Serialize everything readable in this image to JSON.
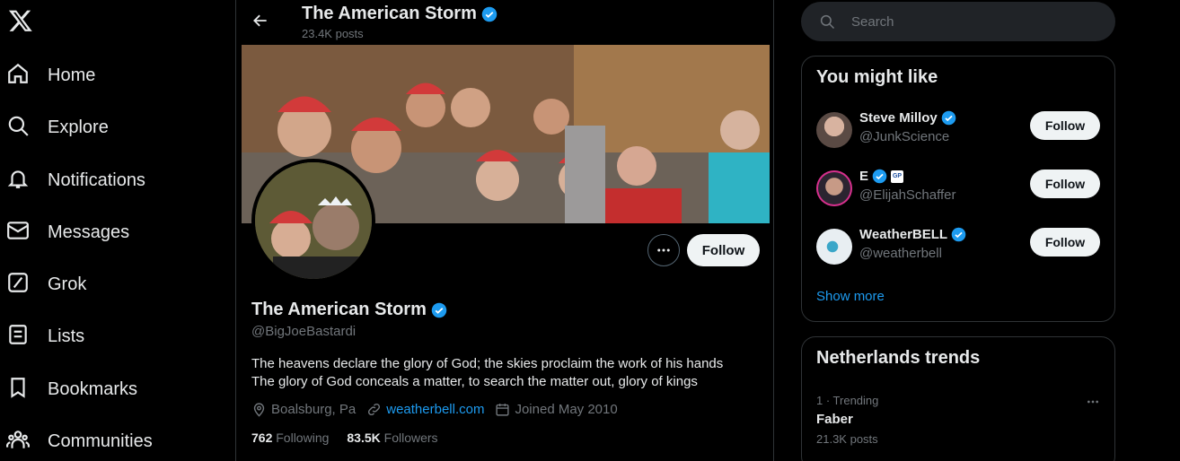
{
  "nav": {
    "logo": "X",
    "items": [
      {
        "label": "Home",
        "icon": "home-icon"
      },
      {
        "label": "Explore",
        "icon": "search-icon"
      },
      {
        "label": "Notifications",
        "icon": "bell-icon"
      },
      {
        "label": "Messages",
        "icon": "mail-icon"
      },
      {
        "label": "Grok",
        "icon": "grok-icon"
      },
      {
        "label": "Lists",
        "icon": "list-icon"
      },
      {
        "label": "Bookmarks",
        "icon": "bookmark-icon"
      },
      {
        "label": "Communities",
        "icon": "people-icon"
      }
    ]
  },
  "profile": {
    "header_name": "The American Storm",
    "posts_count": "23.4K posts",
    "name": "The American Storm",
    "handle": "@BigJoeBastardi",
    "bio_line1": "The heavens declare the glory of God; the skies proclaim the work of his hands",
    "bio_line2": "The glory of God conceals a matter, to search the matter out, glory of kings",
    "location": "Boalsburg, Pa",
    "website": "weatherbell.com",
    "joined": "Joined May 2010",
    "following_count": "762",
    "following_label": "Following",
    "followers_count": "83.5K",
    "followers_label": "Followers",
    "follow_label": "Follow"
  },
  "search": {
    "placeholder": "Search"
  },
  "you_might_like": {
    "title": "You might like",
    "items": [
      {
        "name": "Steve Milloy",
        "handle": "@JunkScience",
        "follow": "Follow",
        "avatar_color": "#6b5a52"
      },
      {
        "name": "E",
        "handle": "@ElijahSchaffer",
        "follow": "Follow",
        "avatar_color": "#3a2a3a",
        "badge": "GP"
      },
      {
        "name": "WeatherBELL",
        "handle": "@weatherbell",
        "follow": "Follow",
        "avatar_color": "#e8eef2"
      }
    ],
    "show_more": "Show more"
  },
  "trends": {
    "title": "Netherlands trends",
    "items": [
      {
        "meta": "1 · Trending",
        "name": "Faber",
        "posts": "21.3K posts"
      }
    ]
  },
  "colors": {
    "accent": "#1d9bf0",
    "border": "#2f3336",
    "muted": "#71767b"
  }
}
